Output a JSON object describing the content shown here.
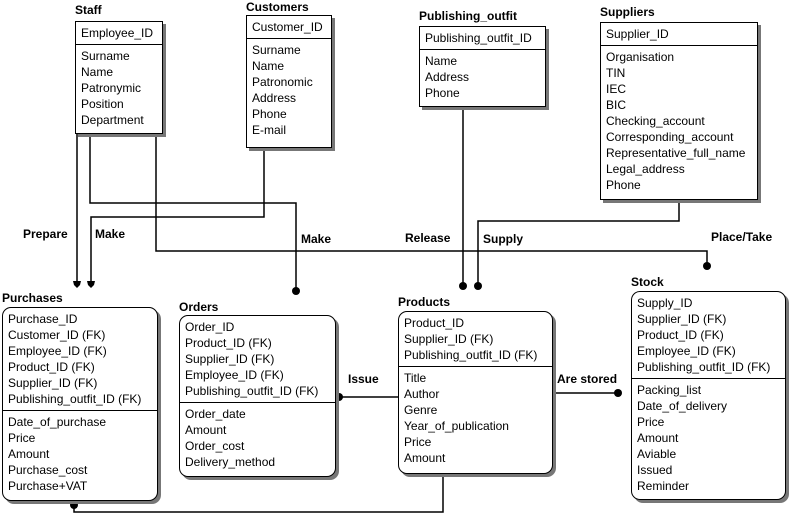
{
  "entities": [
    {
      "id": "staff",
      "title": "Staff",
      "keys": [
        "Employee_ID"
      ],
      "attrs": [
        "Surname",
        "Name",
        "Patronymic",
        "Position",
        "Department"
      ]
    },
    {
      "id": "customers",
      "title": "Customers",
      "keys": [
        "Customer_ID"
      ],
      "attrs": [
        "Surname",
        "Name",
        "Patronomic",
        "Address",
        "Phone",
        "E-mail"
      ]
    },
    {
      "id": "publishing_outfit",
      "title": "Publishing_outfit",
      "keys": [
        "Publishing_outfit_ID"
      ],
      "attrs": [
        "Name",
        "Address",
        "Phone"
      ]
    },
    {
      "id": "suppliers",
      "title": "Suppliers",
      "keys": [
        "Supplier_ID"
      ],
      "attrs": [
        "Organisation",
        "TIN",
        "IEC",
        "BIC",
        "Checking_account",
        "Corresponding_account",
        "Representative_full_name",
        "Legal_address",
        "Phone"
      ]
    },
    {
      "id": "purchases",
      "title": "Purchases",
      "keys": [
        "Purchase_ID",
        "Customer_ID (FK)",
        "Employee_ID (FK)",
        "Product_ID (FK)",
        "Supplier_ID (FK)",
        "Publishing_outfit_ID (FK)"
      ],
      "attrs": [
        "Date_of_purchase",
        "Price",
        "Amount",
        "Purchase_cost",
        "Purchase+VAT"
      ]
    },
    {
      "id": "orders",
      "title": "Orders",
      "keys": [
        "Order_ID",
        "Product_ID (FK)",
        "Supplier_ID (FK)",
        "Employee_ID (FK)",
        "Publishing_outfit_ID (FK)"
      ],
      "attrs": [
        "Order_date",
        "Amount",
        "Order_cost",
        "Delivery_method"
      ]
    },
    {
      "id": "products",
      "title": "Products",
      "keys": [
        "Product_ID",
        "Supplier_ID (FK)",
        "Publishing_outfit_ID (FK)"
      ],
      "attrs": [
        "Title",
        "Author",
        "Genre",
        "Year_of_publication",
        "Price",
        "Amount"
      ]
    },
    {
      "id": "stock",
      "title": "Stock",
      "keys": [
        "Supply_ID",
        "Supplier_ID (FK)",
        "Product_ID (FK)",
        "Employee_ID (FK)",
        "Publishing_outfit_ID (FK)"
      ],
      "attrs": [
        "Packing_list",
        "Date_of_delivery",
        "Price",
        "Amount",
        "Aviable",
        "Issued",
        "Reminder"
      ]
    }
  ],
  "relationships": [
    {
      "label": "Prepare",
      "from": "staff",
      "to": "purchases"
    },
    {
      "label": "Make",
      "from": "customers",
      "to": "purchases"
    },
    {
      "label": "Make",
      "from": "staff",
      "to": "orders"
    },
    {
      "label": "Release",
      "from": "publishing_outfit",
      "to": "products"
    },
    {
      "label": "Supply",
      "from": "suppliers",
      "to": "products"
    },
    {
      "label": "Place/Take",
      "from": "staff",
      "to": "stock"
    },
    {
      "label": "Issue",
      "from": "products",
      "to": "orders"
    },
    {
      "label": "Are stored",
      "from": "products",
      "to": "stock"
    },
    {
      "label": "",
      "from": "products",
      "to": "purchases"
    }
  ]
}
